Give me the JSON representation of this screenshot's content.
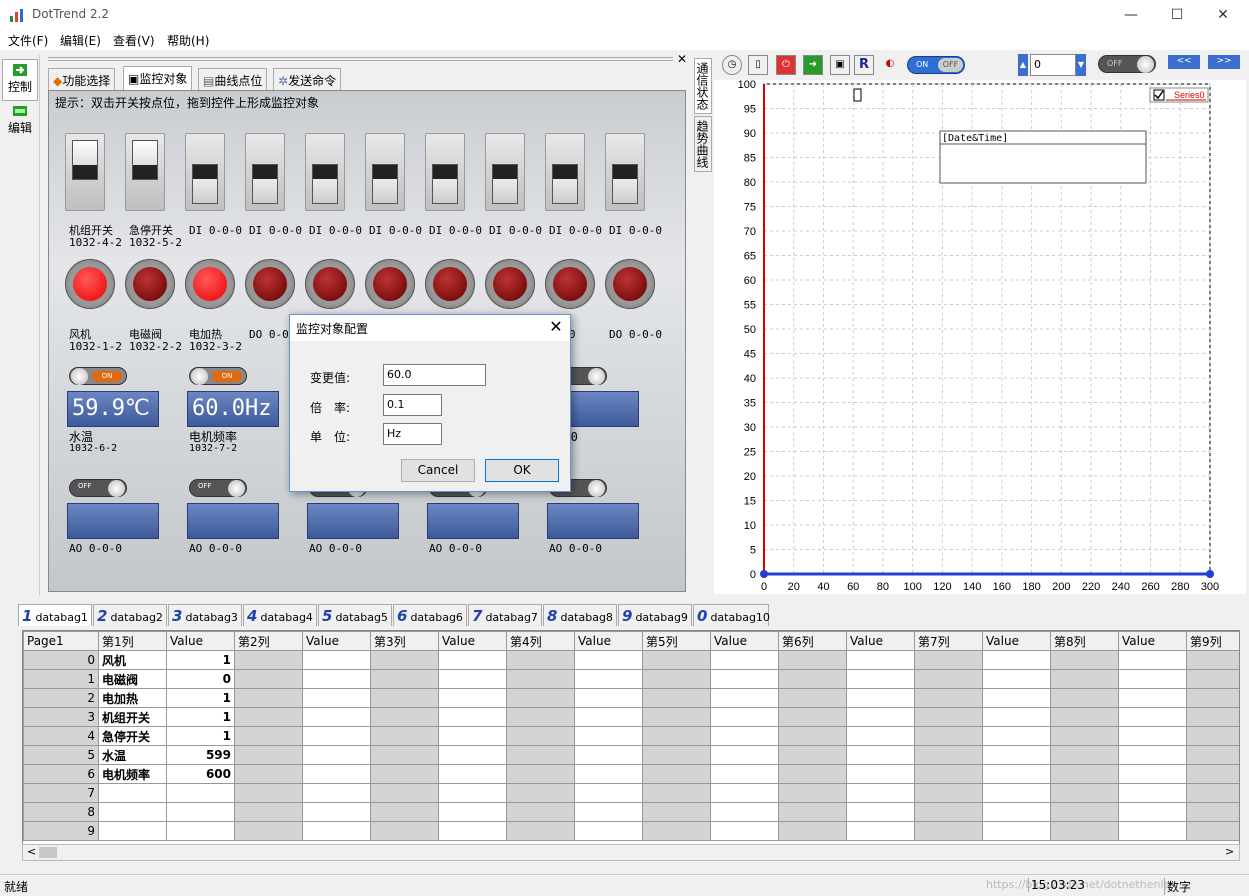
{
  "app": {
    "title": "DotTrend 2.2",
    "window_controls": [
      "—",
      "☐",
      "✕"
    ]
  },
  "menu": [
    "文件(F)",
    "编辑(E)",
    "查看(V)",
    "帮助(H)"
  ],
  "sidebar": [
    {
      "label": "控制",
      "icon": "control-icon"
    },
    {
      "label": "编辑",
      "icon": "edit-icon"
    }
  ],
  "left_tabs": [
    {
      "label": "功能选择",
      "selected": false
    },
    {
      "label": "监控对象",
      "selected": true
    },
    {
      "label": "曲线点位",
      "selected": false
    },
    {
      "label": "发送命令",
      "selected": false
    }
  ],
  "hint": "提示：双击开关按点位，拖到控件上形成监控对象",
  "switches": [
    {
      "name": "机组开关",
      "addr": "1032-4-2",
      "on": true
    },
    {
      "name": "急停开关",
      "addr": "1032-5-2",
      "on": true
    },
    {
      "name": "DI 0-0-0",
      "addr": "",
      "on": false
    },
    {
      "name": "DI 0-0-0",
      "addr": "",
      "on": false
    },
    {
      "name": "DI 0-0-0",
      "addr": "",
      "on": false
    },
    {
      "name": "DI 0-0-0",
      "addr": "",
      "on": false
    },
    {
      "name": "DI 0-0-0",
      "addr": "",
      "on": false
    },
    {
      "name": "DI 0-0-0",
      "addr": "",
      "on": false
    },
    {
      "name": "DI 0-0-0",
      "addr": "",
      "on": false
    },
    {
      "name": "DI 0-0-0",
      "addr": "",
      "on": false
    }
  ],
  "lamps": [
    {
      "name": "风机",
      "addr": "1032-1-2",
      "lit": true
    },
    {
      "name": "电磁阀",
      "addr": "1032-2-2",
      "lit": false
    },
    {
      "name": "电加热",
      "addr": "1032-3-2",
      "lit": true
    },
    {
      "name": "DO 0-0-0",
      "addr": "",
      "lit": false
    },
    {
      "name": "",
      "addr": "",
      "lit": false
    },
    {
      "name": "",
      "addr": "",
      "lit": false
    },
    {
      "name": "",
      "addr": "",
      "lit": false
    },
    {
      "name": "",
      "addr": "",
      "lit": false
    },
    {
      "name": "-0-0",
      "addr": "",
      "lit": false
    },
    {
      "name": "DO 0-0-0",
      "addr": "",
      "lit": false
    }
  ],
  "analog_in": [
    {
      "toggle": "ON",
      "display": "59.9℃",
      "name": "水温",
      "addr": "1032-6-2"
    },
    {
      "toggle": "ON",
      "display": "60.0Hz",
      "name": "电机频率",
      "addr": "1032-7-2"
    },
    {
      "toggle": "",
      "display": "",
      "name": "",
      "addr": ""
    },
    {
      "toggle": "",
      "display": "",
      "name": "",
      "addr": ""
    },
    {
      "toggle": "OFF",
      "display": "",
      "name": "-0-0",
      "addr": ""
    }
  ],
  "analog_out": [
    {
      "toggle": "OFF",
      "name": "AO 0-0-0"
    },
    {
      "toggle": "OFF",
      "name": "AO 0-0-0"
    },
    {
      "toggle": "OFF",
      "name": "AO 0-0-0"
    },
    {
      "toggle": "OFF",
      "name": "AO 0-0-0"
    },
    {
      "toggle": "OFF",
      "name": "AO 0-0-0"
    }
  ],
  "dialog": {
    "title": "监控对象配置",
    "fields": [
      {
        "label": "变更值:",
        "value": "60.0"
      },
      {
        "label": "倍　率:",
        "value": "0.1"
      },
      {
        "label": "单　位:",
        "value": "Hz"
      }
    ],
    "cancel": "Cancel",
    "ok": "OK"
  },
  "vertical_tabs": [
    "通信状态",
    "趋势曲线"
  ],
  "chart_toolbar": {
    "toggle_on": "ON",
    "toggle_off": "OFF",
    "spin_value": "0",
    "toggle2": "OFF",
    "prev": "<<",
    "next": ">>",
    "r_label": "R"
  },
  "chart_data": {
    "type": "line",
    "title": "",
    "xlabel": "",
    "ylabel": "",
    "xlim": [
      0,
      300
    ],
    "ylim": [
      0,
      100
    ],
    "x_ticks": [
      0,
      20,
      40,
      60,
      80,
      100,
      120,
      140,
      160,
      180,
      200,
      220,
      240,
      260,
      280,
      300
    ],
    "y_ticks": [
      0,
      5,
      10,
      15,
      20,
      25,
      30,
      35,
      40,
      45,
      50,
      55,
      60,
      65,
      70,
      75,
      80,
      85,
      90,
      95,
      100
    ],
    "grid": true,
    "legend": "top-right",
    "annotation": "[Date&Time]",
    "series": [
      {
        "name": "Series0",
        "color": "#1f3fd0",
        "x": [
          0,
          300
        ],
        "y": [
          0,
          0
        ]
      }
    ]
  },
  "databags": [
    {
      "num": "1",
      "label": "databag1",
      "selected": true
    },
    {
      "num": "2",
      "label": "databag2",
      "selected": false
    },
    {
      "num": "3",
      "label": "databag3",
      "selected": false
    },
    {
      "num": "4",
      "label": "databag4",
      "selected": false
    },
    {
      "num": "5",
      "label": "databag5",
      "selected": false
    },
    {
      "num": "6",
      "label": "databag6",
      "selected": false
    },
    {
      "num": "7",
      "label": "databag7",
      "selected": false
    },
    {
      "num": "8",
      "label": "databag8",
      "selected": false
    },
    {
      "num": "9",
      "label": "databag9",
      "selected": false
    },
    {
      "num": "0",
      "label": "databag10",
      "selected": false
    }
  ],
  "grid": {
    "corner": "Page1",
    "headers": [
      "第1列",
      "Value",
      "第2列",
      "Value",
      "第3列",
      "Value",
      "第4列",
      "Value",
      "第5列",
      "Value",
      "第6列",
      "Value",
      "第7列",
      "Value",
      "第8列",
      "Value",
      "第9列"
    ],
    "rows": [
      {
        "idx": "0",
        "name": "风机",
        "value": "1"
      },
      {
        "idx": "1",
        "name": "电磁阀",
        "value": "0"
      },
      {
        "idx": "2",
        "name": "电加热",
        "value": "1"
      },
      {
        "idx": "3",
        "name": "机组开关",
        "value": "1"
      },
      {
        "idx": "4",
        "name": "急停开关",
        "value": "1"
      },
      {
        "idx": "5",
        "name": "水温",
        "value": "599"
      },
      {
        "idx": "6",
        "name": "电机频率",
        "value": "600"
      },
      {
        "idx": "7",
        "name": "",
        "value": ""
      },
      {
        "idx": "8",
        "name": "",
        "value": ""
      },
      {
        "idx": "9",
        "name": "",
        "value": ""
      }
    ]
  },
  "status": {
    "left": "就绪",
    "time": "15:03:23",
    "mode": "数字",
    "watermark": "https://blog.csdn.net/dotnethenlp"
  }
}
